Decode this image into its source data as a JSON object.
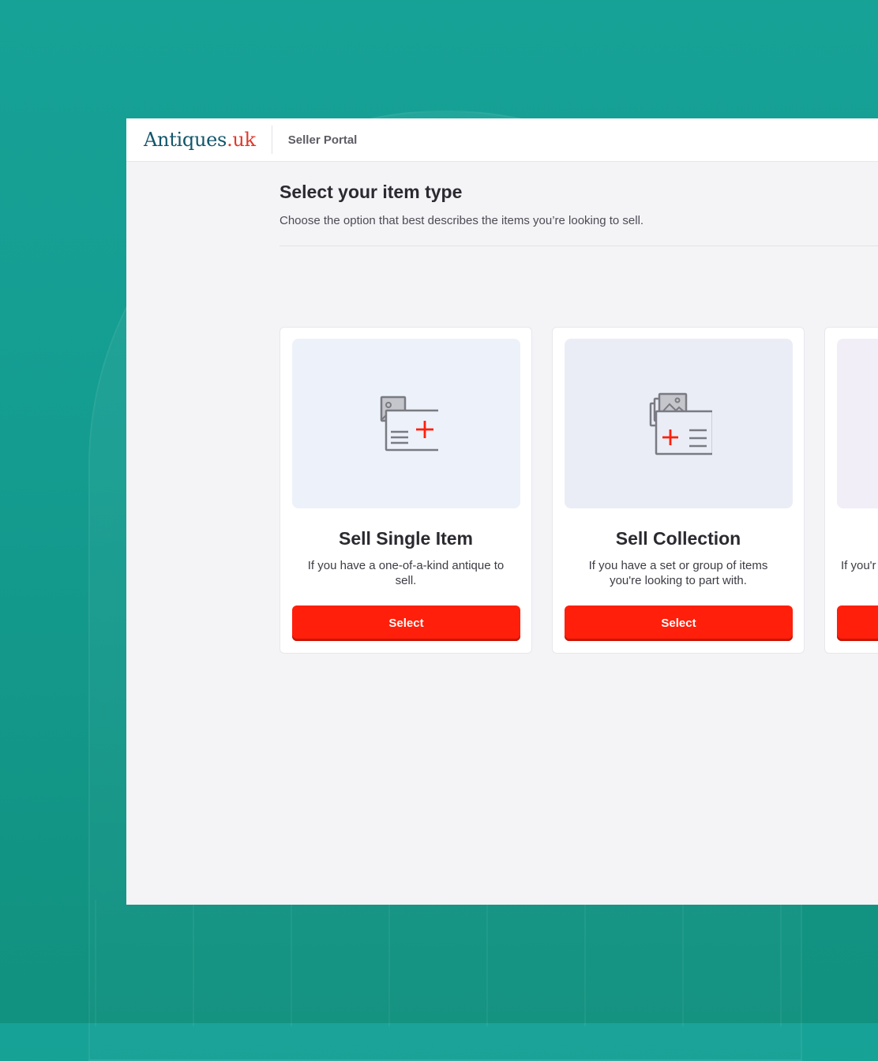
{
  "brand": {
    "name_part1": "Antiques",
    "name_part2": ".uk",
    "portal_label": "Seller Portal"
  },
  "page": {
    "title": "Select your item type",
    "subtitle": "Choose the option that best describes the items you’re looking to sell."
  },
  "cards": [
    {
      "title": "Sell Single Item",
      "description": "If you have a one-of-a-kind antique to sell.",
      "button_label": "Select",
      "icon": "single-item-icon",
      "thumb_color": "#edf1f9"
    },
    {
      "title": "Sell Collection",
      "description": "If you have a set or group of items you're looking to part with.",
      "button_label": "Select",
      "icon": "collection-icon",
      "thumb_color": "#ebedf6"
    },
    {
      "title": "",
      "description": "If you'r",
      "button_label": "",
      "icon": "",
      "thumb_color": "#f1eef7"
    }
  ],
  "colors": {
    "accent": "#ff1f0a",
    "brand_blue": "#12566b",
    "brand_red": "#e3362a",
    "background": "#17a297"
  }
}
